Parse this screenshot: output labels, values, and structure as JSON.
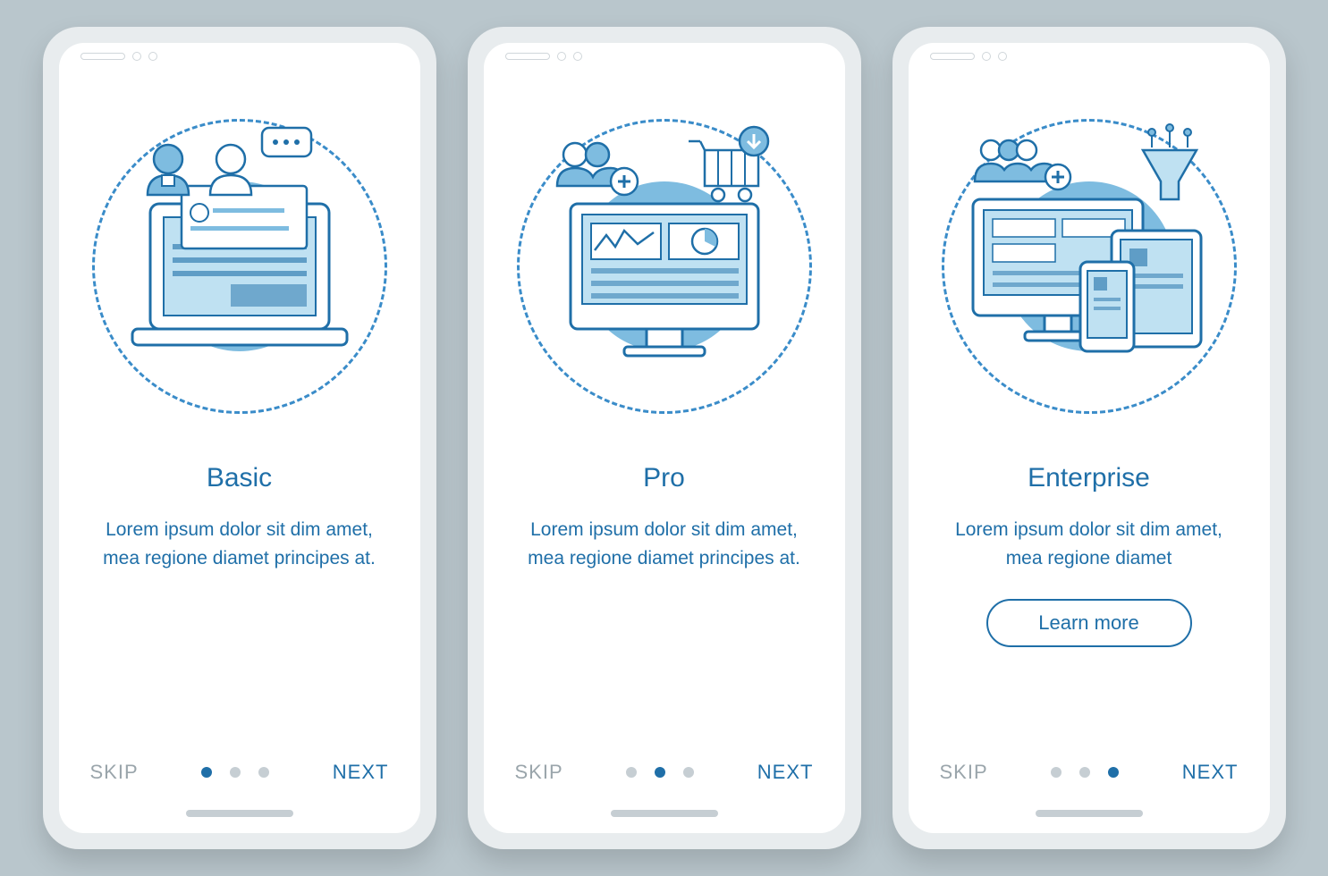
{
  "colors": {
    "primary": "#1f6fa8",
    "accent": "#7ebce0",
    "muted": "#9aa5ab"
  },
  "screens": [
    {
      "id": "basic",
      "title": "Basic",
      "description": "Lorem ipsum dolor sit dim amet, mea regione diamet principes at.",
      "skip_label": "SKIP",
      "next_label": "NEXT",
      "active_dot": 0,
      "has_cta": false
    },
    {
      "id": "pro",
      "title": "Pro",
      "description": "Lorem ipsum dolor sit dim amet, mea regione diamet principes at.",
      "skip_label": "SKIP",
      "next_label": "NEXT",
      "active_dot": 1,
      "has_cta": false
    },
    {
      "id": "enterprise",
      "title": "Enterprise",
      "description": "Lorem ipsum dolor sit dim amet, mea regione diamet",
      "skip_label": "SKIP",
      "next_label": "NEXT",
      "active_dot": 2,
      "has_cta": true,
      "cta_label": "Learn more"
    }
  ]
}
